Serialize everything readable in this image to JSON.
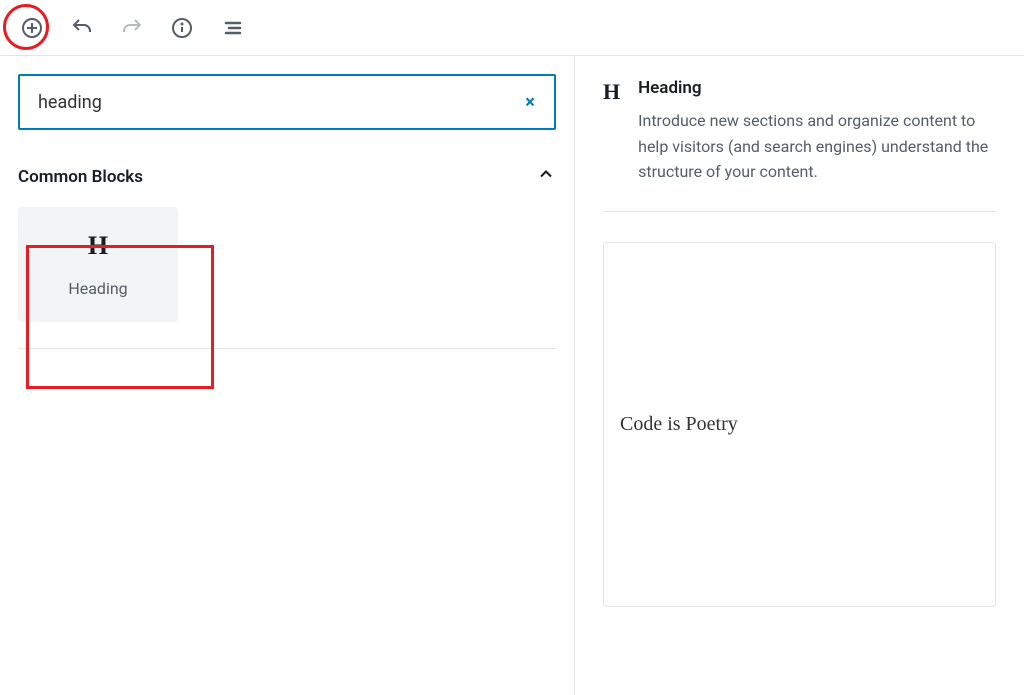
{
  "toolbar": {
    "add": "Add block",
    "undo": "Undo",
    "redo": "Redo",
    "info": "Content structure",
    "outline": "Block navigation"
  },
  "search": {
    "value": "heading",
    "clear": "×"
  },
  "category": {
    "title": "Common Blocks"
  },
  "block": {
    "icon": "H",
    "label": "Heading"
  },
  "detail": {
    "icon": "H",
    "title": "Heading",
    "description": "Introduce new sections and organize content to help visitors (and search engines) understand the structure of your content."
  },
  "preview": {
    "content": "Code is Poetry"
  }
}
